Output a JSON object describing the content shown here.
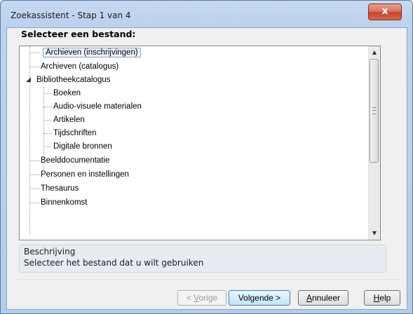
{
  "window": {
    "title": "Zoekassistent - Stap 1 van 4",
    "close_glyph": "x"
  },
  "heading": "Selecteer een bestand:",
  "tree": {
    "items": [
      {
        "label": "Archieven (inschrijvingen)",
        "level": 0,
        "selected": true
      },
      {
        "label": "Archieven (catalogus)",
        "level": 0
      },
      {
        "label": "Bibliotheekcatalogus",
        "level": 0,
        "expanded": true
      },
      {
        "label": "Boeken",
        "level": 1
      },
      {
        "label": "Audio-visuele materialen",
        "level": 1
      },
      {
        "label": "Artikelen",
        "level": 1
      },
      {
        "label": "Tijdschriften",
        "level": 1
      },
      {
        "label": "Digitale bronnen",
        "level": 1
      },
      {
        "label": "Beelddocumentatie",
        "level": 0
      },
      {
        "label": "Personen en instellingen",
        "level": 0
      },
      {
        "label": "Thesaurus",
        "level": 0
      },
      {
        "label": "Binnenkomst",
        "level": 0
      }
    ],
    "expander_icon": "triangle-expanded-icon"
  },
  "description": {
    "title": "Beschrijving",
    "text": "Selecteer het bestand dat u wilt gebruiken"
  },
  "buttons": {
    "prev": {
      "pre": "< ",
      "accel": "V",
      "post": "orige"
    },
    "next": "Volgende >",
    "cancel": {
      "accel": "A",
      "post": "nnuleer"
    },
    "help": {
      "accel": "H",
      "post": "elp"
    }
  },
  "colors": {
    "accent": "#3c7fb1",
    "close_red": "#c6432d"
  }
}
